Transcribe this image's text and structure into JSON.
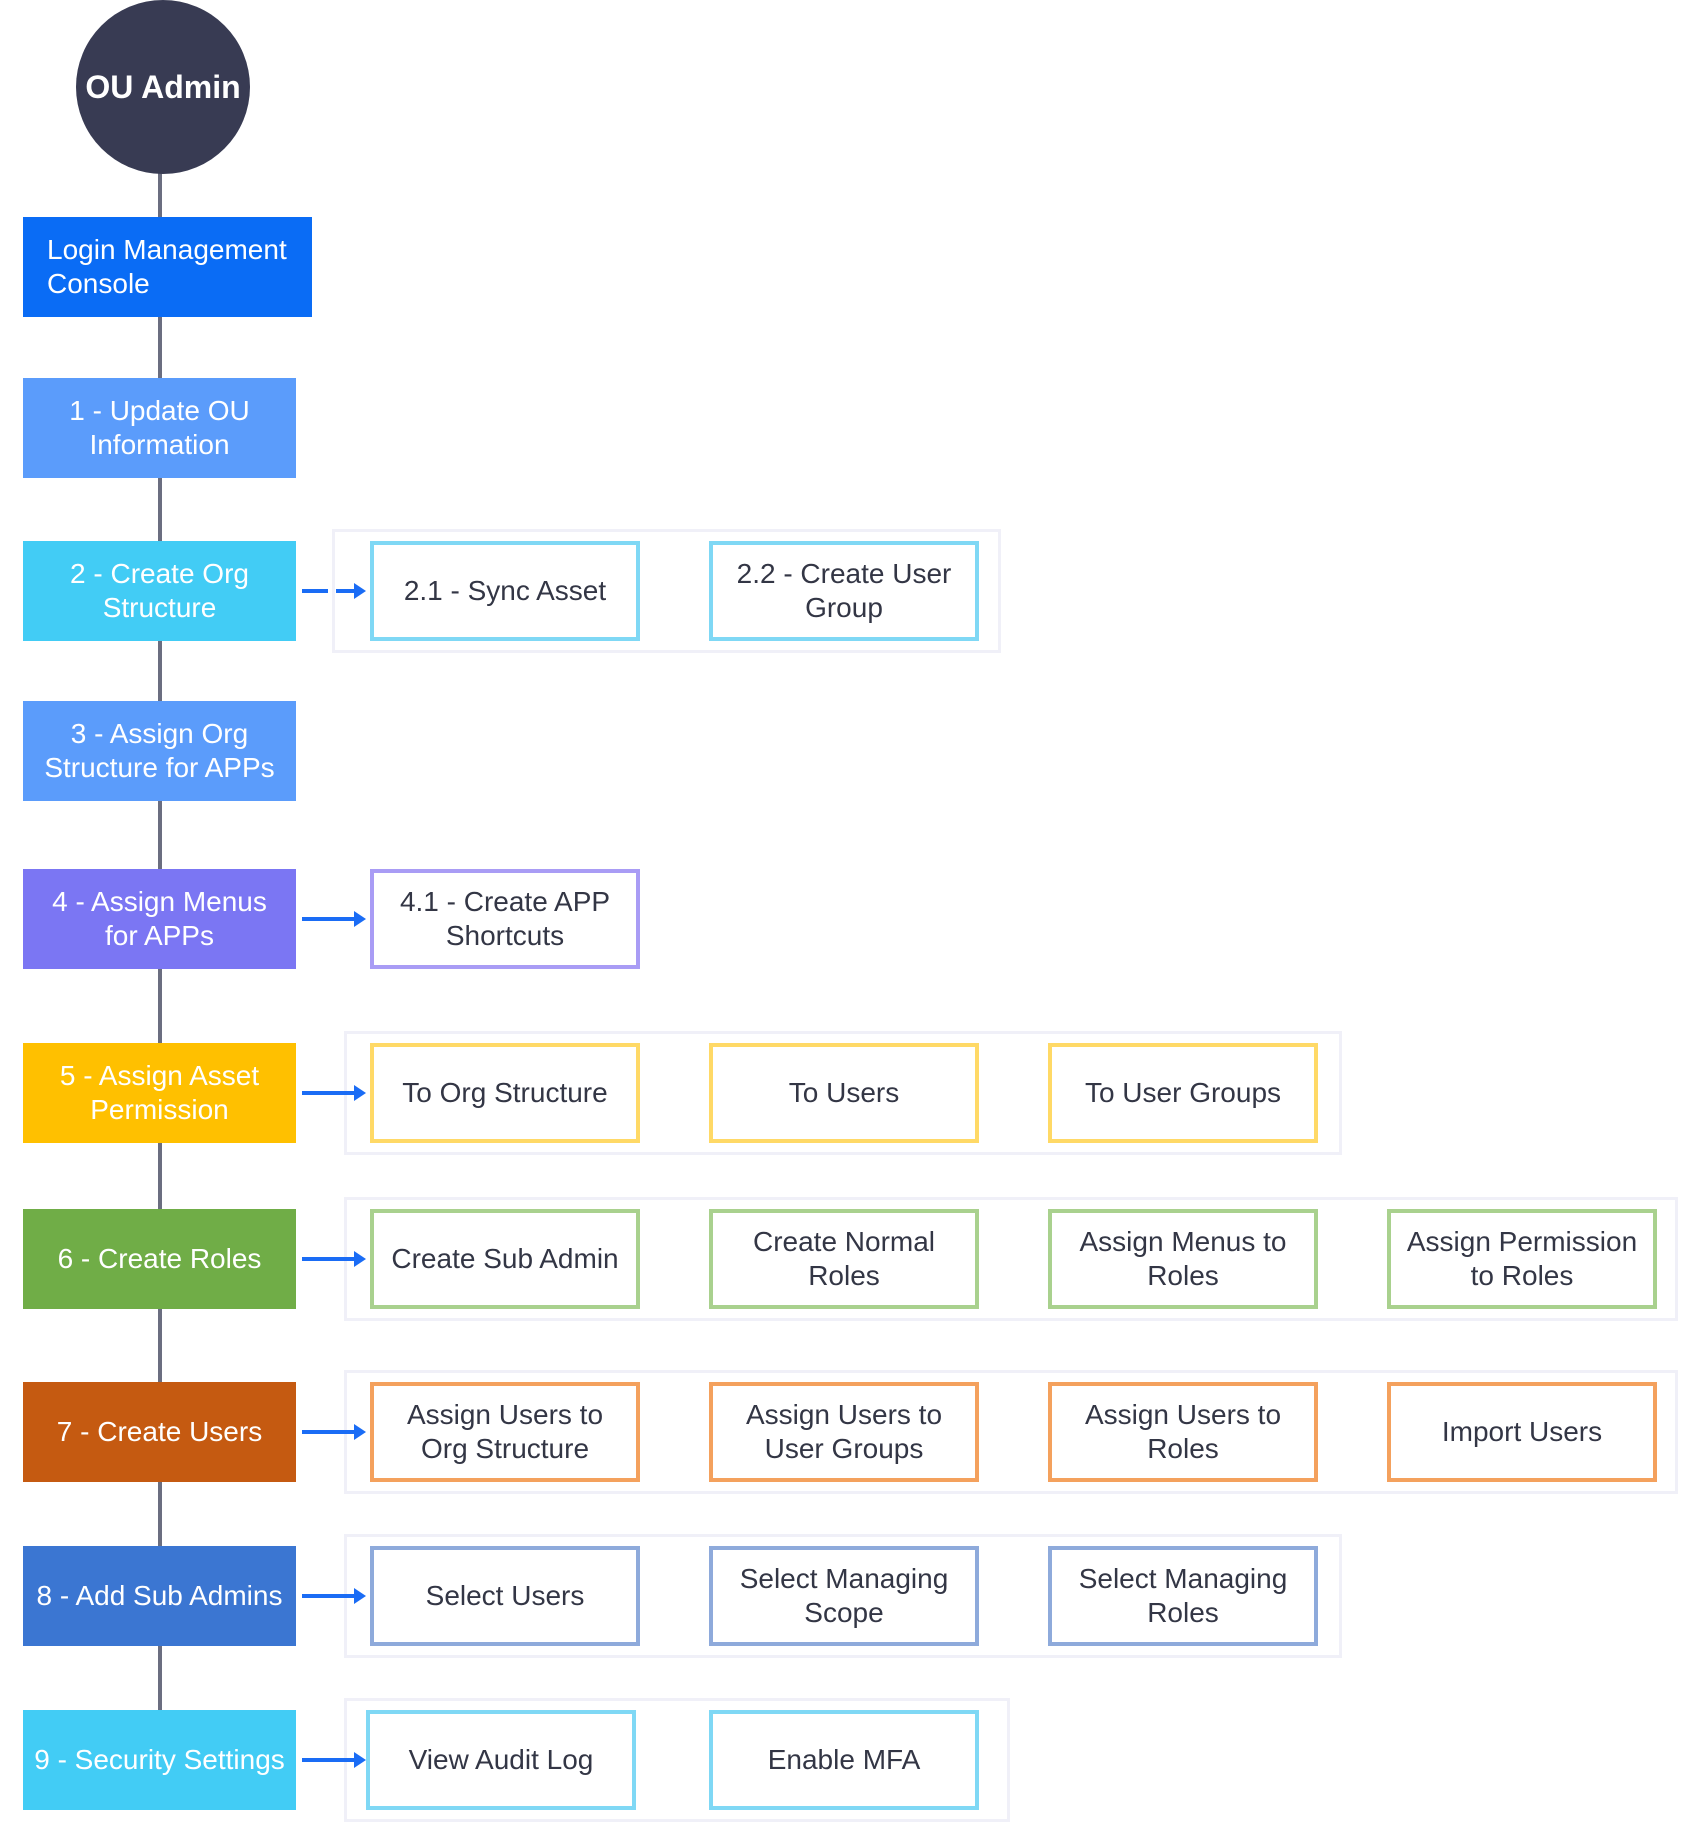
{
  "root": {
    "label": "OU Admin",
    "color": "#383b53"
  },
  "steps": [
    {
      "label": "Login Management Console",
      "color": "#0a6cf5"
    },
    {
      "label": "1 - Update OU Information",
      "color": "#5b9cfb"
    },
    {
      "label": "2 - Create Org Structure",
      "color": "#42ccf5",
      "subs": [
        "2.1 - Sync Asset",
        "2.2 - Create User Group"
      ],
      "sub_border": "#7fd8f5"
    },
    {
      "label": "3 - Assign Org Structure for APPs",
      "color": "#5b9cfb"
    },
    {
      "label": "4 - Assign Menus for APPs",
      "color": "#7b76f3",
      "subs": [
        "4.1 - Create APP Shortcuts"
      ],
      "sub_border": "#a99cf5"
    },
    {
      "label": "5 - Assign Asset Permission",
      "color": "#ffc000",
      "subs": [
        "To Org Structure",
        "To Users",
        "To User Groups"
      ],
      "sub_border": "#ffd966"
    },
    {
      "label": "6 - Create Roles",
      "color": "#70ad47",
      "subs": [
        "Create Sub Admin",
        "Create Normal Roles",
        "Assign Menus to Roles",
        "Assign Permission to Roles"
      ],
      "sub_border": "#a9d18e"
    },
    {
      "label": "7 - Create Users",
      "color": "#c55a11",
      "subs": [
        "Assign Users to Org Structure",
        "Assign Users to User Groups",
        "Assign Users to Roles",
        "Import Users"
      ],
      "sub_border": "#f4a15d"
    },
    {
      "label": "8 - Add Sub Admins",
      "color": "#3b76d2",
      "subs": [
        "Select Users",
        "Select Managing Scope",
        "Select Managing Roles"
      ],
      "sub_border": "#8eaadb"
    },
    {
      "label": "9 - Security Settings",
      "color": "#42ccf5",
      "subs": [
        "View Audit Log",
        "Enable MFA"
      ],
      "sub_border": "#7fd8f5"
    }
  ],
  "arrow_color": "#1a6cf5"
}
